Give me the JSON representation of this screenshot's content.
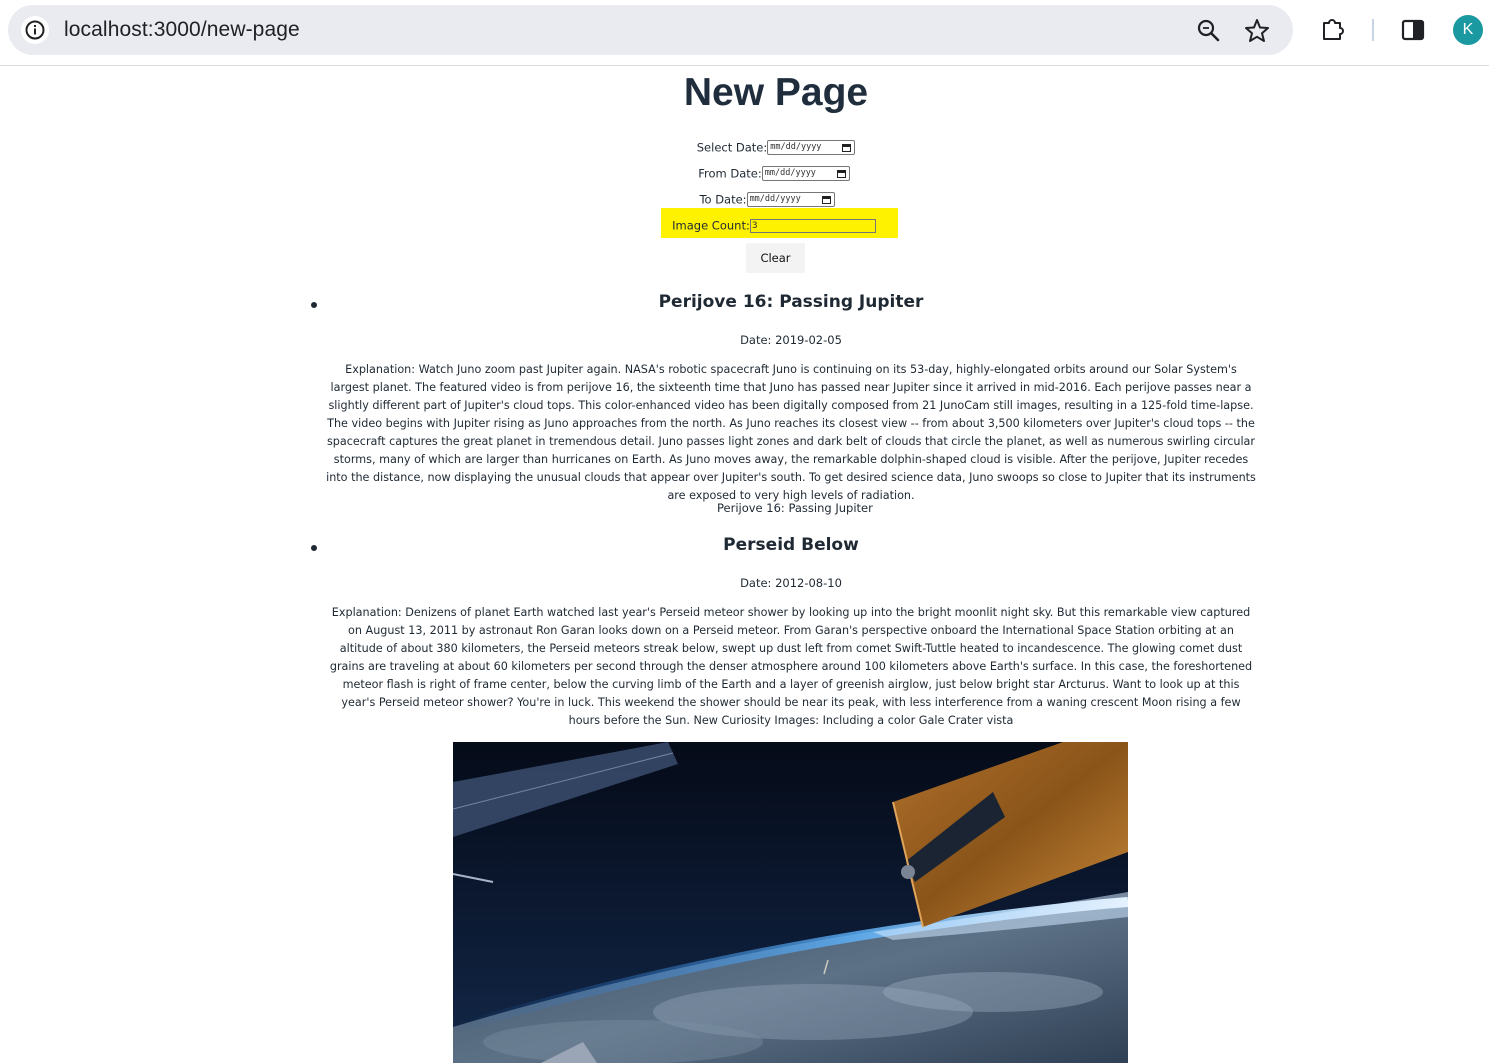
{
  "browser": {
    "url": "localhost:3000/new-page",
    "avatar_letter": "K",
    "icons": [
      "info-icon",
      "zoom-icon",
      "star-icon",
      "extensions-icon",
      "side-panel-icon"
    ]
  },
  "page": {
    "title": "New Page",
    "form": {
      "select_date_label": "Select Date:",
      "from_date_label": "From Date:",
      "to_date_label": "To Date:",
      "date_placeholder": "mm/dd/yyyy",
      "image_count_label": "Image Count:",
      "image_count_value": "3",
      "clear_label": "Clear"
    },
    "items": [
      {
        "title": "Perijove 16: Passing Jupiter",
        "date": "Date: 2019-02-05",
        "explanation": "Explanation: Watch Juno zoom past Jupiter again. NASA's robotic spacecraft Juno is continuing on its 53-day, highly-elongated orbits around our Solar System's largest planet. The featured video is from perijove 16, the sixteenth time that Juno has passed near Jupiter since it arrived in mid-2016. Each perijove passes near a slightly different part of Jupiter's cloud tops. This color-enhanced video has been digitally composed from 21 JunoCam still images, resulting in a 125-fold time-lapse. The video begins with Jupiter rising as Juno approaches from the north. As Juno reaches its closest view -- from about 3,500 kilometers over Jupiter's cloud tops -- the spacecraft captures the great planet in tremendous detail. Juno passes light zones and dark belt of clouds that circle the planet, as well as numerous swirling circular storms, many of which are larger than hurricanes on Earth. As Juno moves away, the remarkable dolphin-shaped cloud is visible. After the perijove, Jupiter recedes into the distance, now displaying the unusual clouds that appear over Jupiter's south. To get desired science data, Juno swoops so close to Jupiter that its instruments are exposed to very high levels of radiation.",
        "image_alt": "Perijove 16: Passing Jupiter"
      },
      {
        "title": "Perseid Below",
        "date": "Date: 2012-08-10",
        "explanation": "Explanation: Denizens of planet Earth watched last year's Perseid meteor shower by looking up into the bright moonlit night sky. But this remarkable view captured on August 13, 2011 by astronaut Ron Garan looks down on a Perseid meteor. From Garan's perspective onboard the International Space Station orbiting at an altitude of about 380 kilometers, the Perseid meteors streak below, swept up dust left from comet Swift-Tuttle heated to incandescence. The glowing comet dust grains are traveling at about 60 kilometers per second through the denser atmosphere around 100 kilometers above Earth's surface. In this case, the foreshortened meteor flash is right of frame center, below the curving limb of the Earth and a layer of greenish airglow, just below bright star Arcturus. Want to look up at this year's Perseid meteor shower? You're in luck. This weekend the shower should be near its peak, with less interference from a waning crescent Moon rising a few hours before the Sun. New Curiosity Images: Including a color Gale Crater vista"
      }
    ]
  },
  "colors": {
    "highlight": "#fff200",
    "avatar_bg": "#1a99a0",
    "omnibox_bg": "#e9ebf0"
  }
}
